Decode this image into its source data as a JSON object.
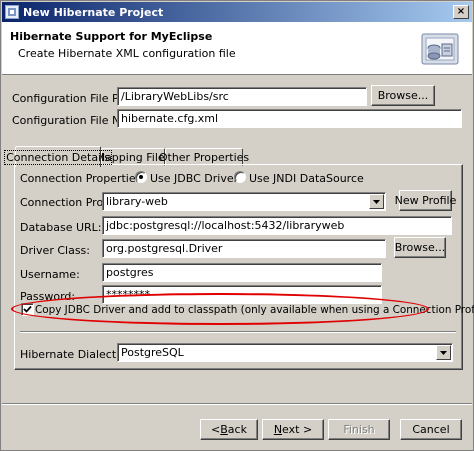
{
  "window": {
    "title": "New Hibernate Project",
    "close_glyph": "×"
  },
  "banner": {
    "title": "Hibernate Support for MyEclipse",
    "subtitle": "Create Hibernate XML configuration file",
    "icon": "hibernate-config-wizard-icon"
  },
  "config": {
    "file_path_label": "Configuration File Path:",
    "file_path_value": "/LibraryWebLibs/src",
    "file_path_browse": "Browse...",
    "file_name_label": "Configuration File Name:",
    "file_name_value": "hibernate.cfg.xml"
  },
  "tabs": [
    {
      "label": "Connection Details",
      "active": true
    },
    {
      "label": "Mapping Files",
      "active": false
    },
    {
      "label": "Other Properties",
      "active": false
    }
  ],
  "connection": {
    "properties_label": "Connection Properties:",
    "radio_jdbc": "Use JDBC Driver",
    "radio_jndi": "Use JNDI DataSource",
    "selected": "jdbc",
    "profile_label": "Connection Profile:",
    "profile_value": "library-web",
    "new_profile_button": "New Profile",
    "db_url_label": "Database URL:",
    "db_url_value": "jdbc:postgresql://localhost:5432/libraryweb",
    "driver_label": "Driver Class:",
    "driver_value": "org.postgresql.Driver",
    "driver_browse": "Browse...",
    "username_label": "Username:",
    "username_value": "postgres",
    "password_label": "Password:",
    "password_value": "********",
    "copy_driver_label": "Copy JDBC Driver and add to classpath (only available when using a Connection Profile)",
    "copy_driver_checked": true,
    "dialect_label": "Hibernate Dialect:",
    "dialect_value": "PostgreSQL"
  },
  "footer": {
    "back_pre": "< ",
    "back_mn": "B",
    "back_post": "ack",
    "next_mn": "N",
    "next_post": "ext >",
    "finish": "Finish",
    "cancel": "Cancel"
  },
  "colors": {
    "highlight": "#e00000",
    "titlebar_start": "#0a246a",
    "titlebar_end": "#a6caf0"
  }
}
